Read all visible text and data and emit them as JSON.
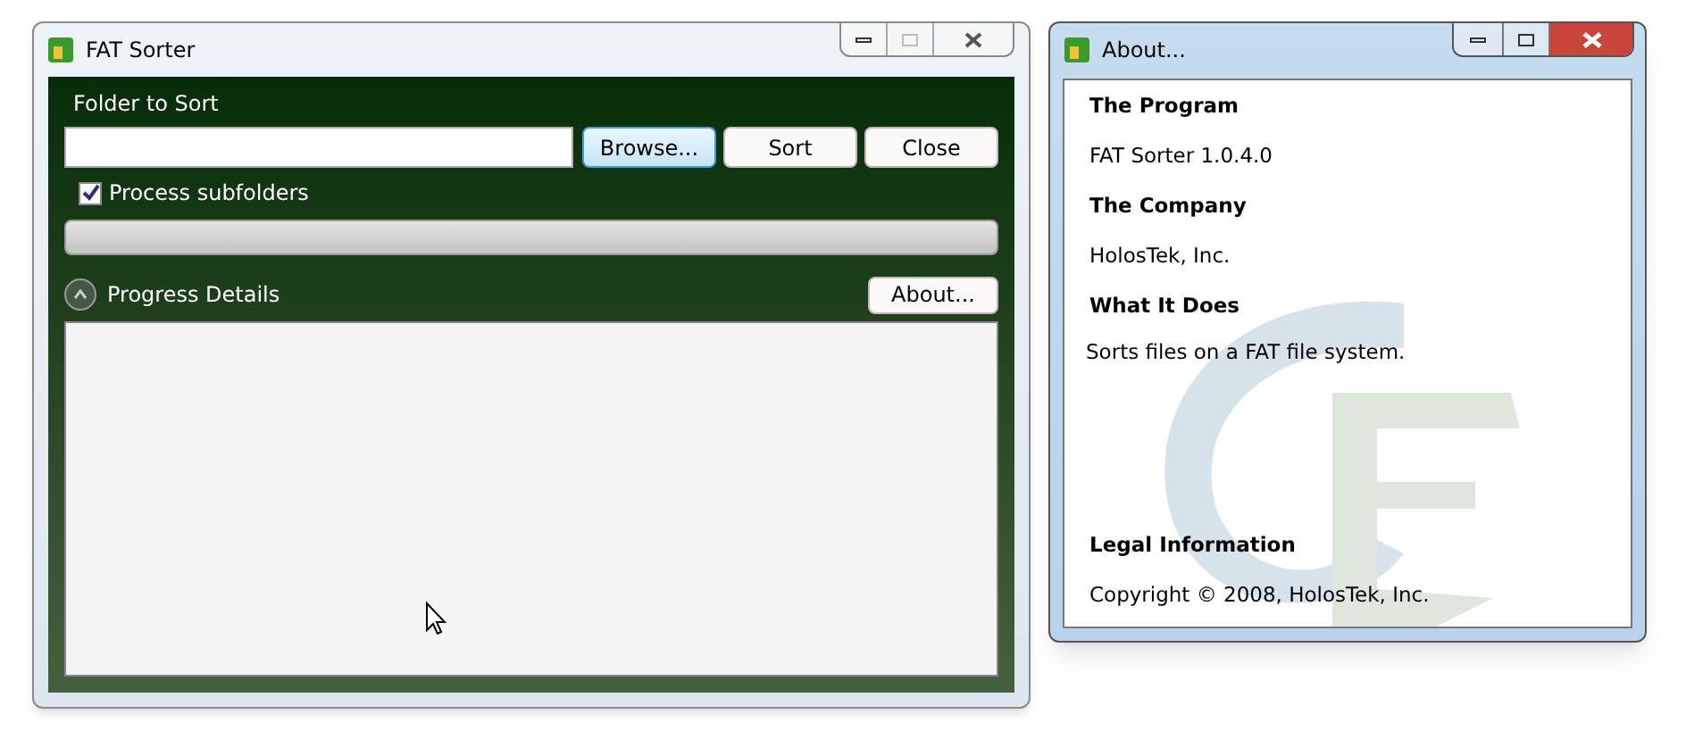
{
  "main_window": {
    "title": "FAT Sorter",
    "folder_label": "Folder to Sort",
    "buttons": [
      {
        "label": "Browse...",
        "focused": true
      },
      {
        "label": "Sort",
        "focused": false
      },
      {
        "label": "Close",
        "focused": false
      }
    ],
    "process_subfolders": {
      "label": "Process subfolders",
      "checked": true
    },
    "progress": {
      "level": 0
    },
    "details": {
      "label": "Progress Details",
      "expanded": true
    },
    "about_button": {
      "label": "About..."
    }
  },
  "about_window": {
    "title": "About...",
    "sections": [
      {
        "heading": "The Program",
        "text": "FAT Sorter 1.0.4.0"
      },
      {
        "heading": "The Company",
        "text": "HolosTek, Inc."
      },
      {
        "heading": "What It Does",
        "text": "Sorts files on a FAT file system."
      },
      {
        "heading": "Legal Information",
        "text": "Copyright © 2008, HolosTek, Inc."
      }
    ]
  }
}
